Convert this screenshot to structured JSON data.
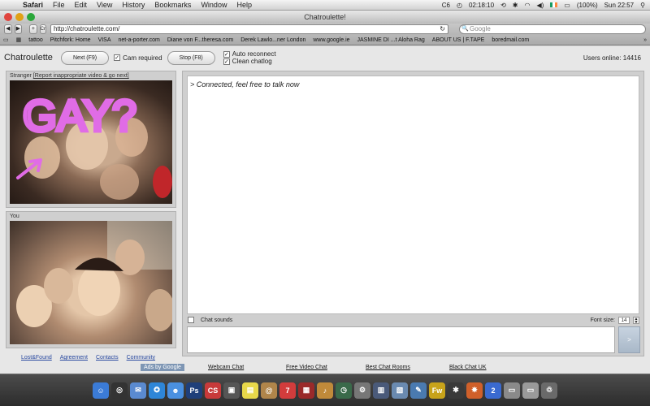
{
  "menubar": {
    "app": "Safari",
    "menus": [
      "File",
      "Edit",
      "View",
      "History",
      "Bookmarks",
      "Window",
      "Help"
    ],
    "clock_time": "02:18:10",
    "battery": "(100%)",
    "datetime": "Sun 22:57",
    "status_code": "C6"
  },
  "window": {
    "title": "Chatroulette!",
    "url": "http://chatroulette.com/",
    "search_placeholder": "Google",
    "reader_label": "Cr"
  },
  "bookmarks": [
    "tattoo",
    "Pitchfork: Home",
    "VISA",
    "net-a-porter.com",
    "Diane von F...theresa.com",
    "Derek Lawlo...ner London",
    "www.google.ie",
    "JASMINE DI ...t Aloha Rag",
    "ABOUT US | F.TAPE",
    "boredmail.com"
  ],
  "page": {
    "logo": "Chatroulette",
    "next_button": "Next (F9)",
    "cam_required": "Cam required",
    "stop_button": "Stop (F8)",
    "auto_reconnect": "Auto reconnect",
    "clean_chatlog": "Clean chatlog",
    "users_online": "Users online: 14416",
    "stranger_label": "Stranger",
    "report_link": "[Report inappropriate video & go next]",
    "you_label": "You",
    "footer_links": [
      "Lost&Found",
      "Agreement",
      "Contacts",
      "Community"
    ],
    "chat_log_line": "> Connected, feel free to talk now",
    "chat_sounds": "Chat sounds",
    "font_size_label": "Font size:",
    "font_size_value": "14",
    "send_label": ">",
    "overlay_text": "GAY?"
  },
  "ads": {
    "ads_by": "Ads by Google",
    "links": [
      "Webcam Chat",
      "Free Video Chat",
      "Best Chat Rooms",
      "Black Chat UK"
    ]
  },
  "dock": [
    {
      "name": "finder",
      "color": "#3b7bd6",
      "glyph": "☺"
    },
    {
      "name": "dashboard",
      "color": "#333333",
      "glyph": "◎"
    },
    {
      "name": "mail",
      "color": "#5a8ad0",
      "glyph": "✉"
    },
    {
      "name": "safari",
      "color": "#2e86d8",
      "glyph": "✪"
    },
    {
      "name": "ichat",
      "color": "#4a90e0",
      "glyph": "☻"
    },
    {
      "name": "photoshop",
      "color": "#1f3f7a",
      "glyph": "Ps"
    },
    {
      "name": "creative-suite",
      "color": "#c83a3a",
      "glyph": "CS"
    },
    {
      "name": "dvd-player",
      "color": "#555555",
      "glyph": "▣"
    },
    {
      "name": "stickies",
      "color": "#e8d84a",
      "glyph": "▤"
    },
    {
      "name": "address-book",
      "color": "#b0854a",
      "glyph": "@"
    },
    {
      "name": "ical",
      "color": "#d23c3c",
      "glyph": "7"
    },
    {
      "name": "photo-booth",
      "color": "#9a2a2a",
      "glyph": "▦"
    },
    {
      "name": "garageband",
      "color": "#c08a3a",
      "glyph": "♪"
    },
    {
      "name": "time-machine",
      "color": "#3a6a4a",
      "glyph": "◷"
    },
    {
      "name": "system-preferences",
      "color": "#777777",
      "glyph": "⚙"
    },
    {
      "name": "expose",
      "color": "#4a5a7a",
      "glyph": "▥"
    },
    {
      "name": "iphoto",
      "color": "#6a8ab0",
      "glyph": "▧"
    },
    {
      "name": "iweb",
      "color": "#4a7ab0",
      "glyph": "✎"
    },
    {
      "name": "fireworks",
      "color": "#c8a31a",
      "glyph": "Fw"
    },
    {
      "name": "image-capture",
      "color": "#3a3a3a",
      "glyph": "✱"
    },
    {
      "name": "bridge",
      "color": "#d0602a",
      "glyph": "✸"
    },
    {
      "name": "app-store-badge",
      "color": "#3a6ad0",
      "glyph": "2"
    },
    {
      "name": "downloads",
      "color": "#8a8a8a",
      "glyph": "▭"
    },
    {
      "name": "documents",
      "color": "#9a9a9a",
      "glyph": "▭"
    },
    {
      "name": "trash",
      "color": "#6a6a6a",
      "glyph": "♲"
    }
  ]
}
